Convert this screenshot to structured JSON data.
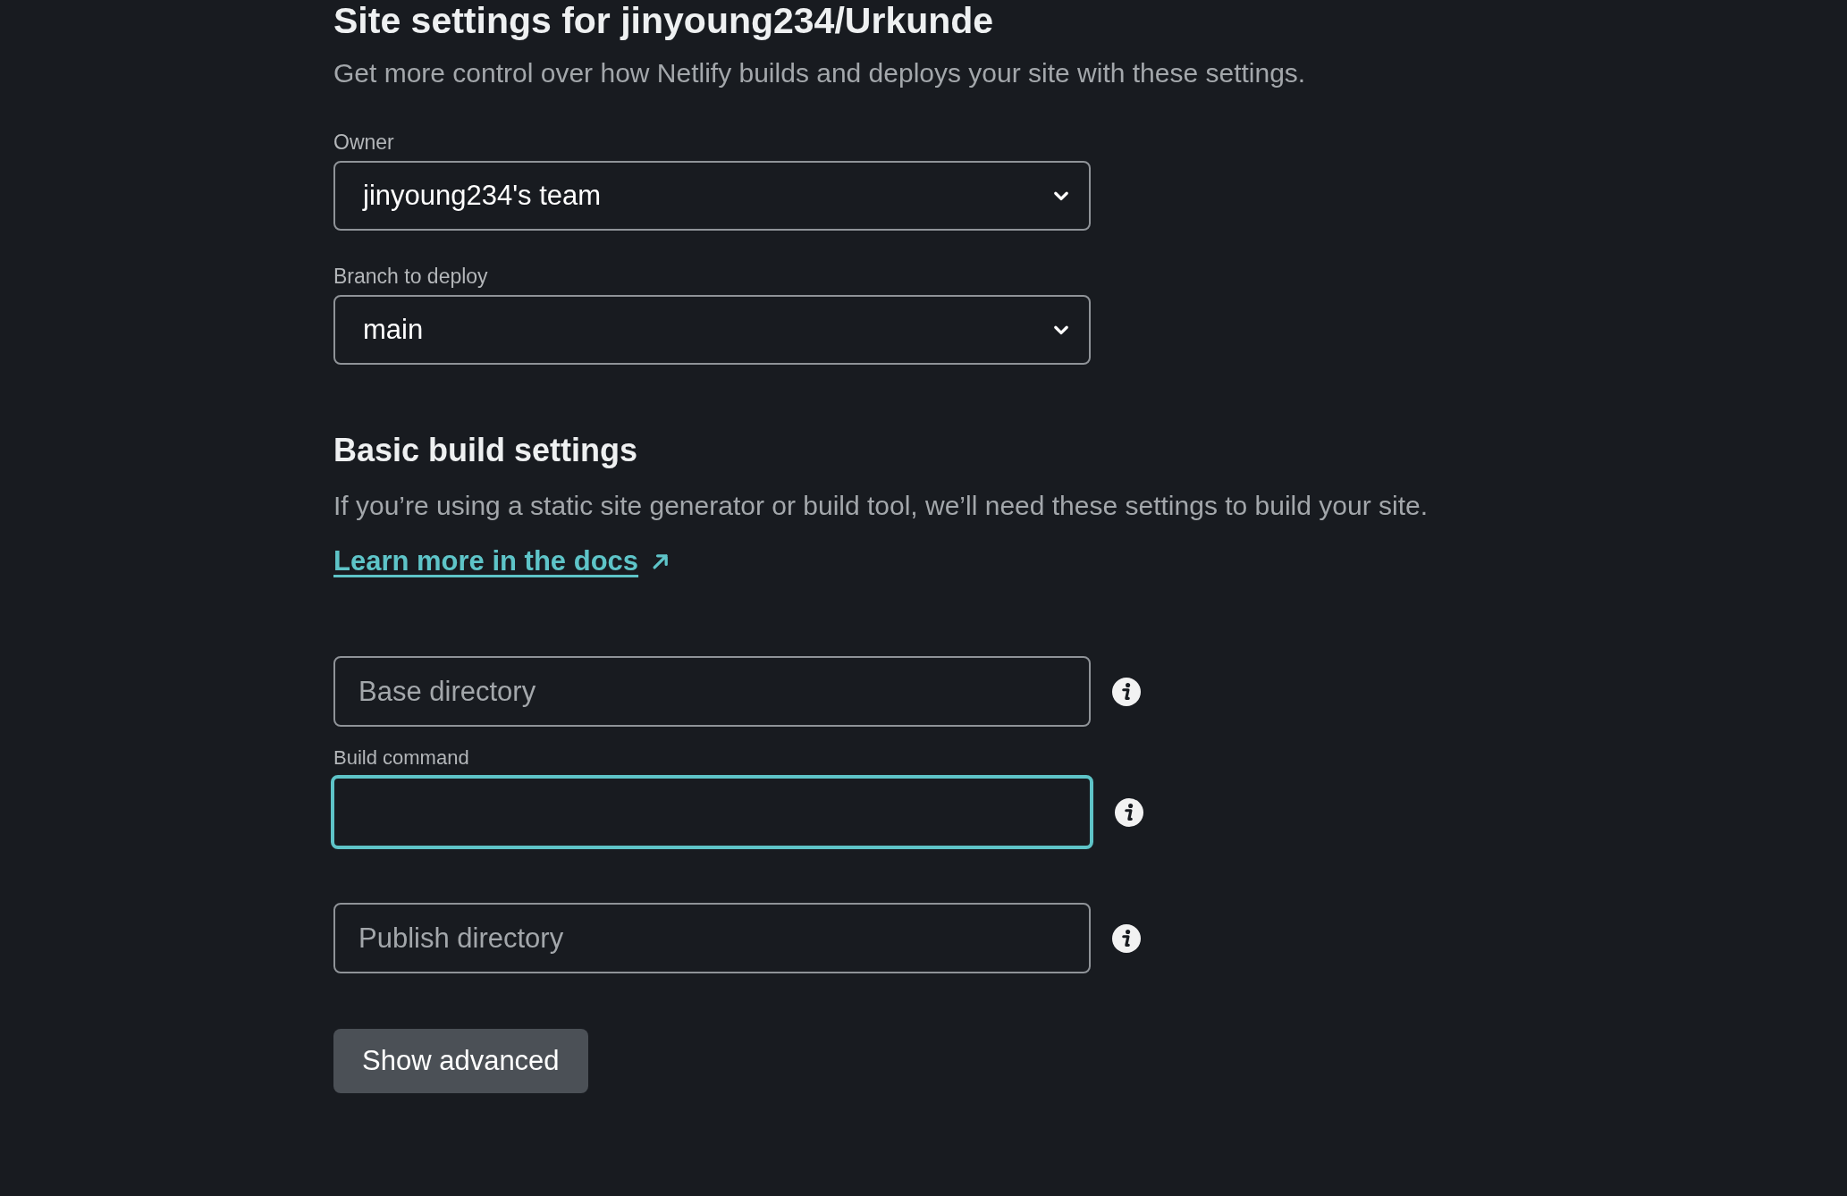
{
  "title": "Site settings for jinyoung234/Urkunde",
  "subtitle": "Get more control over how Netlify builds and deploys your site with these settings.",
  "selects": [
    {
      "label": "Owner",
      "value": "jinyoung234's team"
    },
    {
      "label": "Branch to deploy",
      "value": "main"
    }
  ],
  "build": {
    "heading": "Basic build settings",
    "description": "If you’re using a static site generator or build tool, we’ll need these settings to build your site.",
    "link": "Learn more in the docs",
    "fields": [
      {
        "placeholder": "Base directory",
        "focused": false
      },
      {
        "label": "Build command",
        "focused": true
      },
      {
        "placeholder": "Publish directory",
        "focused": false
      }
    ]
  },
  "button": "Show advanced"
}
